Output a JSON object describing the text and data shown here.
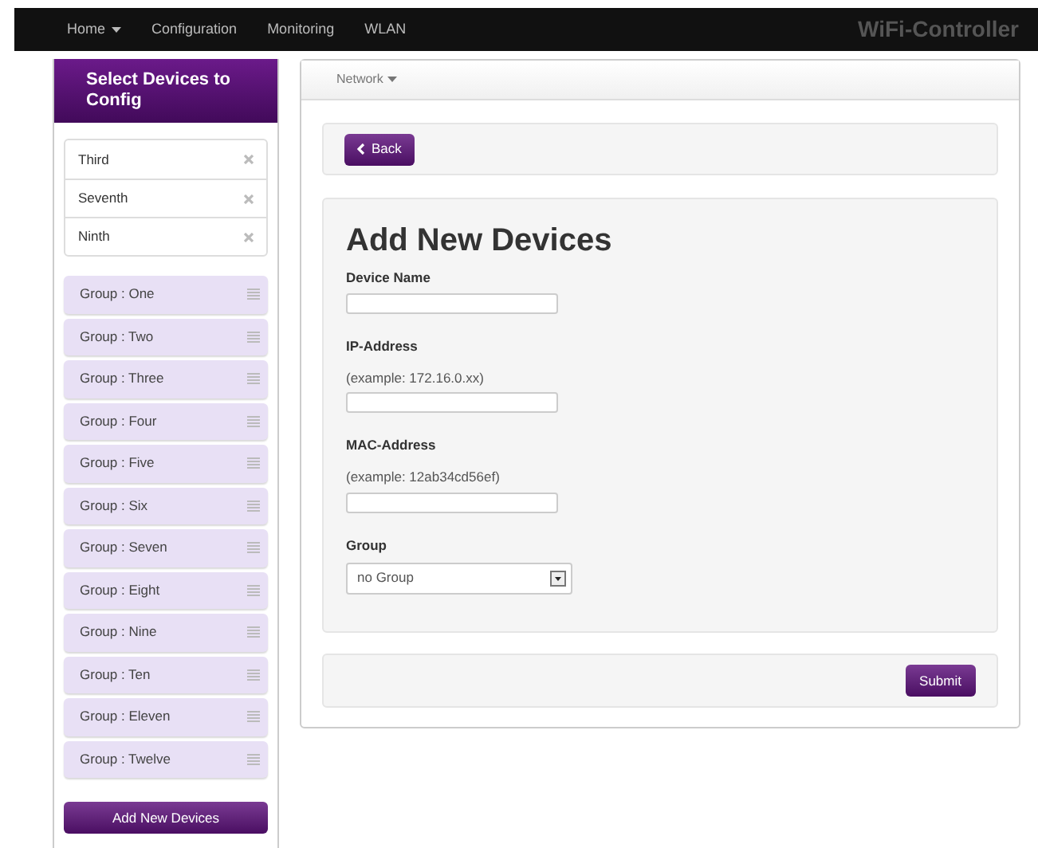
{
  "navbar": {
    "items": [
      {
        "label": "Home",
        "dropdown": true
      },
      {
        "label": "Configuration",
        "dropdown": false
      },
      {
        "label": "Monitoring",
        "dropdown": false
      },
      {
        "label": "WLAN",
        "dropdown": false
      }
    ],
    "brand": "WiFi-Controller"
  },
  "sidebar": {
    "title": "Select Devices to Config",
    "selected_devices": [
      "Third",
      "Seventh",
      "Ninth"
    ],
    "groups": [
      "Group : One",
      "Group : Two",
      "Group : Three",
      "Group : Four",
      "Group : Five",
      "Group : Six",
      "Group : Seven",
      "Group : Eight",
      "Group : Nine",
      "Group : Ten",
      "Group : Eleven",
      "Group : Twelve"
    ],
    "button": "Add New Devices"
  },
  "main": {
    "menu": "Network",
    "back": "Back",
    "title": "Add New Devices",
    "fields": [
      {
        "kind": "text",
        "label": "Device Name"
      },
      {
        "kind": "text",
        "label": "IP-Address",
        "hint": "(example: 172.16.0.xx)"
      },
      {
        "kind": "text",
        "label": "MAC-Address",
        "hint": "(example: 12ab34cd56ef)"
      },
      {
        "kind": "select",
        "label": "Group",
        "value": "no Group"
      }
    ],
    "submit": "Submit"
  }
}
